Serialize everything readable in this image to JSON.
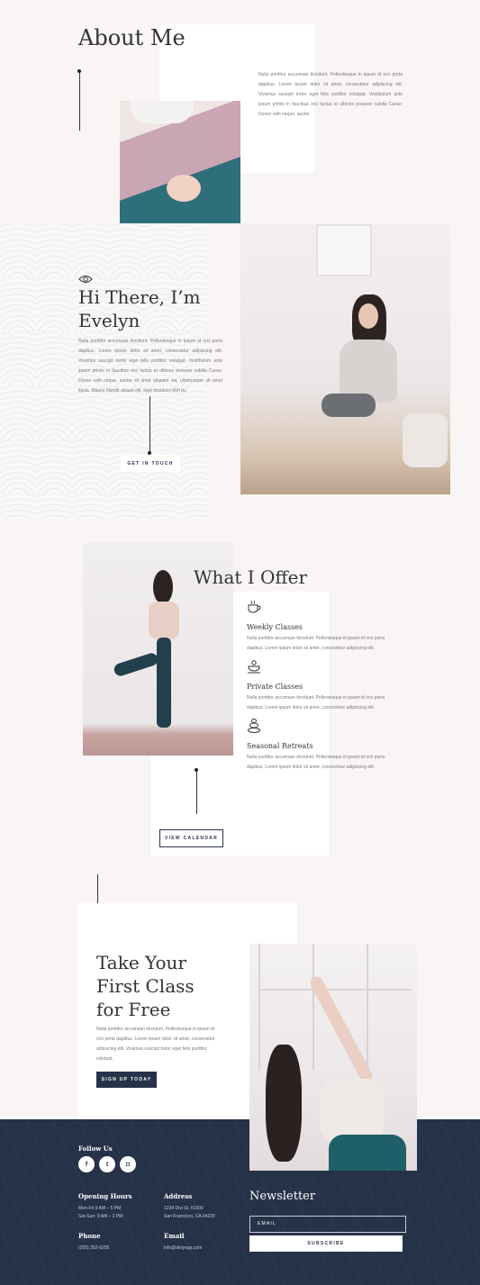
{
  "about": {
    "title": "About Me",
    "body": "Nulla porttitor accumsan tincidunt. Pellentesque in ipsum id orci porta dapibus. Lorem ipsum dolor sit amet, consectetur adipiscing elit. Vivamus suscipit tortor eget felis porttitor volutpat. Vestibulum ante ipsum primis in faucibus orci luctus et ultrices posuere cubilia Curae; Donec velit neque, auctor"
  },
  "intro": {
    "icon": "eye-icon",
    "title_line1": "Hi There, I’m",
    "title_line2": "Evelyn",
    "body": "Nulla porttitor accumsan tincidunt. Pellentesque in ipsum id orci porta dapibus. Lorem ipsum dolor sit amet, consectetur adipiscing elit. Vivamus suscipit tortor eget felis porttitor volutpat. Vestibulum ante ipsum primis in faucibus orci luctus et ultrices posuere cubilia Curae; Donec velit neque, auctor sit amet aliquam vel, ullamcorper sit amet ligula. Mauris blandit aliquet elit, eget tincidunt nibh pu",
    "button": "GET IN TOUCH"
  },
  "offer": {
    "title": "What I Offer",
    "items": [
      {
        "icon": "tea-cup-icon",
        "title": "Weekly Classes",
        "body": "Nulla porttitor accumsan tincidunt. Pellentesque in ipsum id orci porta dapibus. Lorem ipsum dolor sit amet, consectetur adipiscing elit."
      },
      {
        "icon": "singing-bowl-icon",
        "title": "Private Classes",
        "body": "Nulla porttitor accumsan tincidunt. Pellentesque in ipsum id orci porta dapibus. Lorem ipsum dolor sit amet, consectetur adipiscing elit."
      },
      {
        "icon": "stacked-stones-icon",
        "title": "Seasonal Retreats",
        "body": "Nulla porttitor accumsan tincidunt. Pellentesque in ipsum id orci porta dapibus. Lorem ipsum dolor sit amet, consectetur adipiscing elit."
      }
    ],
    "button": "VIEW CALENDAR"
  },
  "cta": {
    "title_line1": "Take Your",
    "title_line2": "First Class",
    "title_line3": "for Free",
    "body": "Nulla porttitor accumsan tincidunt. Pellentesque in ipsum id orci porta dapibus. Lorem ipsum dolor sit amet, consectetur adipiscing elit. Vivamus suscipit tortor eget felis porttitor volutpat.",
    "button": "SIGN UP TODAY"
  },
  "footer": {
    "follow": "Follow Us",
    "social": [
      {
        "icon": "facebook-icon",
        "glyph": "f"
      },
      {
        "icon": "twitter-icon",
        "glyph": "t"
      },
      {
        "icon": "instagram-icon",
        "glyph": "◘"
      }
    ],
    "hours_title": "Opening Hours",
    "hours_line1": "Mon-Fri 9 AM – 5 PM",
    "hours_line2": "Sat-Sun: 9 AM – 2 PM",
    "address_title": "Address",
    "address_line1": "1234 Divi St. #1000",
    "address_line2": "San Francisco, CA 94220",
    "phone_title": "Phone",
    "phone": "(255) 352-6258",
    "email_title": "Email",
    "email": "info@diviyoga.com",
    "newsletter_title": "Newsletter",
    "email_placeholder": "EMAIL",
    "subscribe": "SUBSCRIBE"
  }
}
